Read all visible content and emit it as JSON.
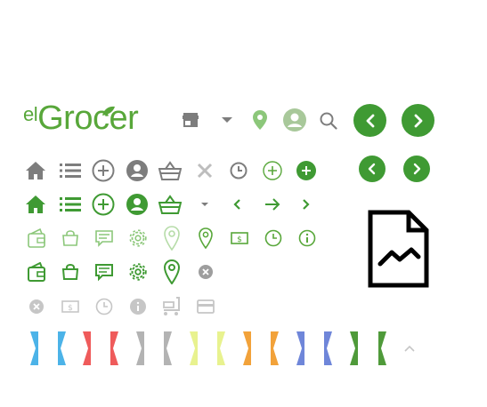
{
  "logo": {
    "prefix": "el",
    "name": "Grocer",
    "brand_color": "#58a73a"
  },
  "colors": {
    "green_dark": "#3f9a33",
    "green_mid": "#58a73a",
    "green_light": "#8cc77a",
    "gray": "#7d7d7d",
    "gray_light": "#bdbdbd",
    "black": "#000000"
  },
  "header_icons": [
    "store-icon",
    "caret-down-icon",
    "location-pin-icon",
    "user-avatar-icon",
    "search-icon",
    "chevron-left-button",
    "chevron-right-button"
  ],
  "rows": {
    "row1_gray": [
      "home-icon",
      "list-icon",
      "add-circle-icon",
      "user-icon",
      "basket-icon",
      "close-x-icon",
      "clock-icon",
      "add-circle-outline-icon",
      "add-circle-filled-icon"
    ],
    "row2_green": [
      "home-icon",
      "list-icon",
      "add-circle-icon",
      "user-icon",
      "basket-icon",
      "caret-down-icon",
      "chevron-left-icon",
      "arrow-right-icon",
      "chevron-right-icon"
    ],
    "row3_light_green": [
      "wallet-icon",
      "bag-icon",
      "chat-icon",
      "gear-icon",
      "location-pin-icon",
      "location-pin-icon",
      "cash-icon",
      "clock-icon",
      "info-icon"
    ],
    "row4_green": [
      "wallet-icon",
      "bag-icon",
      "chat-icon",
      "gear-icon",
      "location-pin-icon",
      "close-circle-icon"
    ],
    "row5_gray_light": [
      "close-circle-icon",
      "cash-icon",
      "clock-icon",
      "info-icon",
      "cart-icon",
      "card-icon"
    ]
  },
  "ribbon_colors": [
    "#4cb3e8",
    "#ef5b5b",
    "#b3b3b3",
    "#e8f28f",
    "#f2a23a",
    "#6f86d9",
    "#4f9a3a"
  ],
  "broken_image": "broken-image-icon",
  "scroll_up": "caret-up-icon"
}
